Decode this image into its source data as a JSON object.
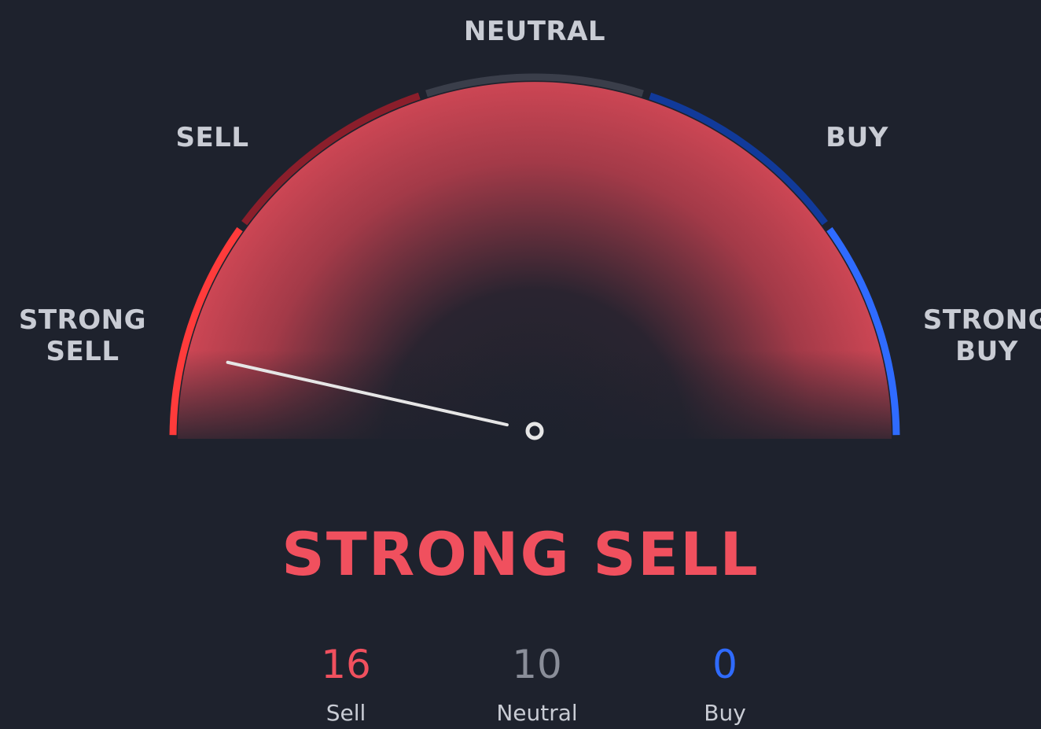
{
  "gauge": {
    "labels": {
      "neutral": "NEUTRAL",
      "sell": "SELL",
      "buy": "BUY",
      "strong_sell_line1": "STRONG",
      "strong_sell_line2": "SELL",
      "strong_buy_line1": "STRONG",
      "strong_buy_line2": "BUY"
    },
    "colors": {
      "strong_sell": "#ff3b3b",
      "sell": "#8b1e2b",
      "neutral": "#3a3e4a",
      "buy": "#113a9a",
      "strong_buy": "#2f6bff",
      "fill": "#c94452",
      "needle": "#e6e6e6"
    },
    "needle_value": -0.86
  },
  "summary": {
    "label": "STRONG SELL",
    "color": "#f0505e"
  },
  "counts": {
    "sell": {
      "value": "16",
      "label": "Sell"
    },
    "neutral": {
      "value": "10",
      "label": "Neutral"
    },
    "buy": {
      "value": "0",
      "label": "Buy"
    }
  }
}
